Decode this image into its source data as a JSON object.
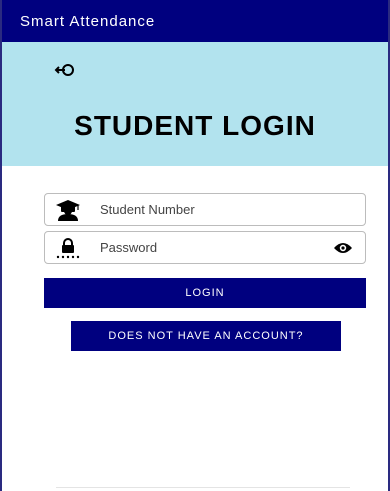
{
  "app_bar": {
    "title": "Smart Attendance"
  },
  "header": {
    "back_icon": "logout-arrow-icon",
    "title": "STUDENT LOGIN",
    "background_color": "#b2e3ee"
  },
  "form": {
    "student_number": {
      "icon": "student-graduate-icon",
      "placeholder": "Student Number",
      "value": ""
    },
    "password": {
      "icon": "password-lock-icon",
      "placeholder": "Password",
      "value": "",
      "toggle_icon": "eye-icon"
    }
  },
  "buttons": {
    "login_label": "LOGIN",
    "signup_label": "DOES NOT HAVE AN ACCOUNT?"
  },
  "colors": {
    "primary": "#00007f",
    "header_panel": "#b2e3ee"
  }
}
